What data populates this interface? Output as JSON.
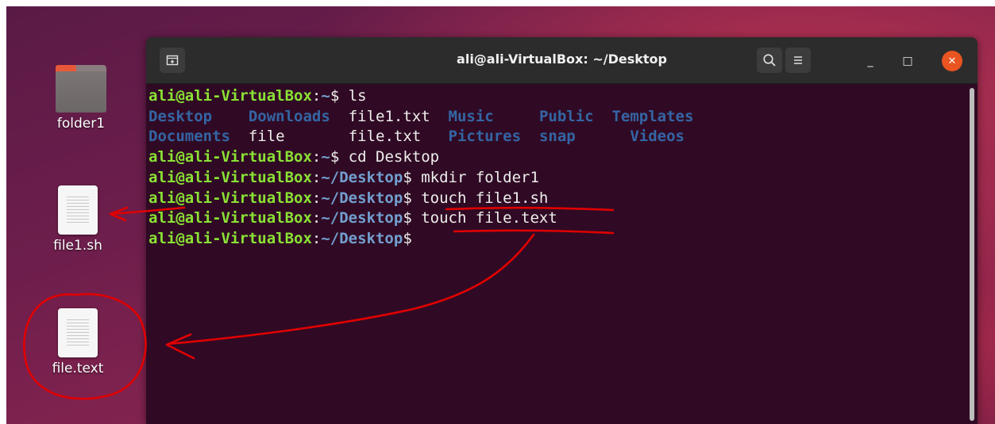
{
  "desktop": {
    "icons": [
      {
        "label": "folder1",
        "icon": "folder-icon"
      },
      {
        "label": "file1.sh",
        "icon": "text-file-icon"
      },
      {
        "label": "file.text",
        "icon": "text-file-icon"
      }
    ]
  },
  "window": {
    "title": "ali@ali-VirtualBox: ~/Desktop",
    "new_tab_icon": "new-tab-icon",
    "search_icon": "search-icon",
    "menu_icon": "hamburger-menu-icon",
    "minimize_glyph": "_",
    "maximize_glyph": "□",
    "close_glyph": "✕"
  },
  "terminal": {
    "prompt_user": "ali@ali-VirtualBox",
    "lines": [
      {
        "path": "~",
        "cmd": "ls"
      },
      {
        "path": "~",
        "cmd": "cd Desktop"
      },
      {
        "path": "~/Desktop",
        "cmd": "mkdir folder1"
      },
      {
        "path": "~/Desktop",
        "cmd": "touch file1.sh"
      },
      {
        "path": "~/Desktop",
        "cmd": "touch file.text"
      },
      {
        "path": "~/Desktop",
        "cmd": ""
      }
    ],
    "ls_rows": [
      [
        "Desktop",
        "Downloads",
        "file1.txt",
        "Music",
        "Public",
        "Templates"
      ],
      [
        "Documents",
        "file",
        "file.txt",
        "Pictures",
        "snap",
        "Videos"
      ]
    ],
    "ls_dirs": [
      "Desktop",
      "Downloads",
      "Music",
      "Public",
      "Templates",
      "Documents",
      "Pictures",
      "snap",
      "Videos"
    ]
  },
  "colors": {
    "terminal_bg": "#300a24",
    "prompt_user": "#8ae234",
    "prompt_path": "#729fcf",
    "dir_listing": "#3465a4",
    "annotation": "#e00000",
    "close_button": "#e95420"
  }
}
